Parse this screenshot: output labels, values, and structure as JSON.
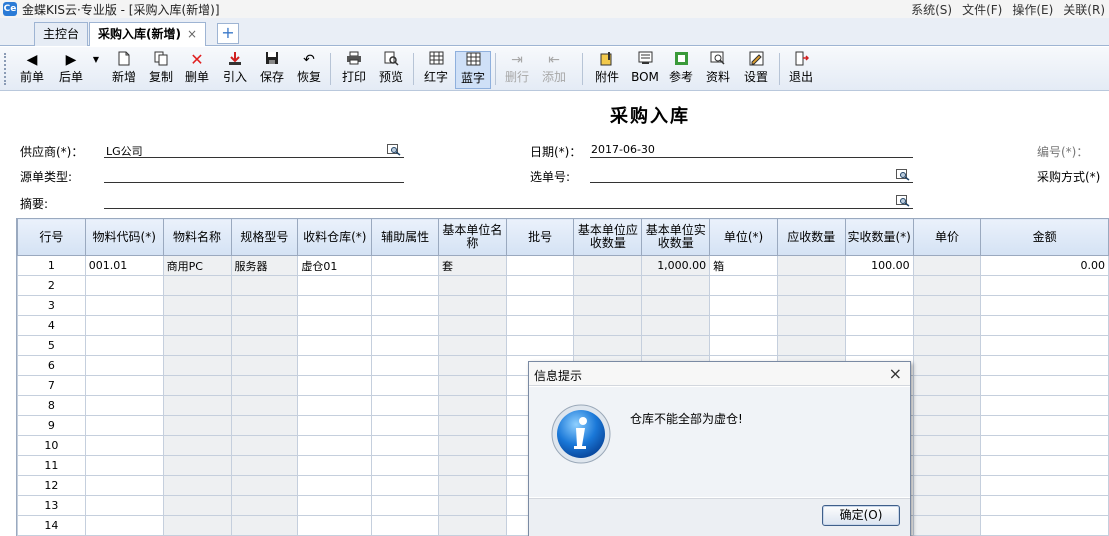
{
  "window": {
    "logo_text": "Ce",
    "title": "金蝶KIS云·专业版 - [采购入库(新增)]"
  },
  "menu": [
    "系统(S)",
    "文件(F)",
    "操作(E)",
    "关联(R)"
  ],
  "tabs": [
    {
      "label": "主控台",
      "active": false
    },
    {
      "label": "采购入库(新增)",
      "active": true,
      "close": "×"
    }
  ],
  "tab_add": "+",
  "toolbar": {
    "prev": "前单",
    "next": "后单",
    "new": "新增",
    "copy": "复制",
    "delete": "删单",
    "import": "引入",
    "save": "保存",
    "restore": "恢复",
    "print": "打印",
    "preview": "预览",
    "red": "红字",
    "blue": "蓝字",
    "delete_row": "删行",
    "add_row": "添加",
    "attach": "附件",
    "bom": "BOM",
    "reference": "参考",
    "data": "资料",
    "settings": "设置",
    "exit": "退出"
  },
  "form": {
    "title": "采购入库",
    "supplier_label": "供应商(*)：",
    "supplier_value": "LG公司",
    "date_label": "日期(*)：",
    "date_value": "2017-06-30",
    "number_label": "编号(*)：",
    "source_type_label": "源单类型:",
    "select_no_label": "选单号:",
    "purchase_method_label": "采购方式(*)",
    "summary_label": "摘要:"
  },
  "grid": {
    "columns": [
      "行号",
      "物料代码(*)",
      "物料名称",
      "规格型号",
      "收料仓库(*)",
      "辅助属性",
      "基本单位名称",
      "批号",
      "基本单位应收数量",
      "基本单位实收数量",
      "单位(*)",
      "应收数量",
      "实收数量(*)",
      "单价",
      "金额"
    ],
    "rows": [
      [
        "1",
        "001.01",
        "商用PC",
        "服务器",
        "虚仓01",
        "",
        "套",
        "",
        "",
        "1,000.00",
        "箱",
        "",
        "100.00",
        "",
        "0.00"
      ],
      [
        "2",
        "",
        "",
        "",
        "",
        "",
        "",
        "",
        "",
        "",
        "",
        "",
        "",
        "",
        ""
      ],
      [
        "3",
        "",
        "",
        "",
        "",
        "",
        "",
        "",
        "",
        "",
        "",
        "",
        "",
        "",
        ""
      ],
      [
        "4",
        "",
        "",
        "",
        "",
        "",
        "",
        "",
        "",
        "",
        "",
        "",
        "",
        "",
        ""
      ],
      [
        "5",
        "",
        "",
        "",
        "",
        "",
        "",
        "",
        "",
        "",
        "",
        "",
        "",
        "",
        ""
      ],
      [
        "6",
        "",
        "",
        "",
        "",
        "",
        "",
        "",
        "",
        "",
        "",
        "",
        "",
        "",
        ""
      ],
      [
        "7",
        "",
        "",
        "",
        "",
        "",
        "",
        "",
        "",
        "",
        "",
        "",
        "",
        "",
        ""
      ],
      [
        "8",
        "",
        "",
        "",
        "",
        "",
        "",
        "",
        "",
        "",
        "",
        "",
        "",
        "",
        ""
      ],
      [
        "9",
        "",
        "",
        "",
        "",
        "",
        "",
        "",
        "",
        "",
        "",
        "",
        "",
        "",
        ""
      ],
      [
        "10",
        "",
        "",
        "",
        "",
        "",
        "",
        "",
        "",
        "",
        "",
        "",
        "",
        "",
        ""
      ],
      [
        "11",
        "",
        "",
        "",
        "",
        "",
        "",
        "",
        "",
        "",
        "",
        "",
        "",
        "",
        ""
      ],
      [
        "12",
        "",
        "",
        "",
        "",
        "",
        "",
        "",
        "",
        "",
        "",
        "",
        "",
        "",
        ""
      ],
      [
        "13",
        "",
        "",
        "",
        "",
        "",
        "",
        "",
        "",
        "",
        "",
        "",
        "",
        "",
        ""
      ],
      [
        "14",
        "",
        "",
        "",
        "",
        "",
        "",
        "",
        "",
        "",
        "",
        "",
        "",
        "",
        ""
      ]
    ]
  },
  "dialog": {
    "title": "信息提示",
    "close": "×",
    "message": "仓库不能全部为虚仓!",
    "icon": "info-icon",
    "ok_label": "确定(O)"
  },
  "colors": {
    "header_bg": "#d4e2f4",
    "readonly_cell": "#eef0f2",
    "accent": "#2b7bd6"
  }
}
